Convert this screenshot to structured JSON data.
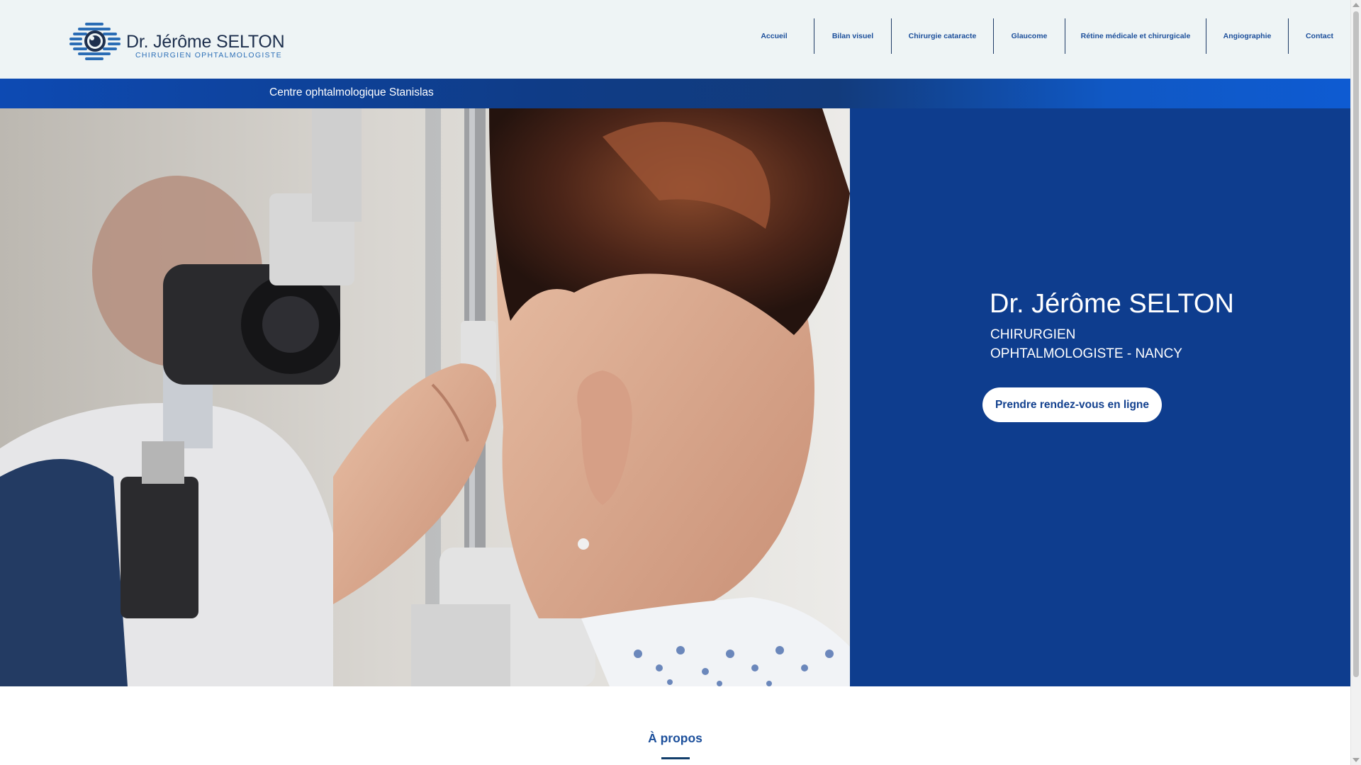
{
  "header": {
    "logo": {
      "name": "Dr. Jérôme SELTON",
      "subtitle": "CHIRURGIEN OPHTALMOLOGISTE",
      "icon": "eye-logo-icon"
    },
    "nav": [
      {
        "label": "Accueil"
      },
      {
        "label": "Bilan visuel"
      },
      {
        "label": "Chirurgie cataracte"
      },
      {
        "label": "Glaucome"
      },
      {
        "label": "Rétine médicale et chirurgicale"
      },
      {
        "label": "Angiographie"
      },
      {
        "label": "Contact"
      }
    ]
  },
  "strip": {
    "text": "Centre ophtalmologique Stanislas"
  },
  "hero": {
    "name": "Dr. Jérôme SELTON",
    "title_line1": "CHIRURGIEN",
    "title_line2": "OPHTALMOLOGISTE - NANCY",
    "cta_label": "Prendre rendez-vous en ligne"
  },
  "about": {
    "title": "À propos"
  },
  "colors": {
    "accent_blue": "#0e3d8e",
    "nav_text": "#1c4f9b",
    "header_bg": "#eef4f5"
  }
}
